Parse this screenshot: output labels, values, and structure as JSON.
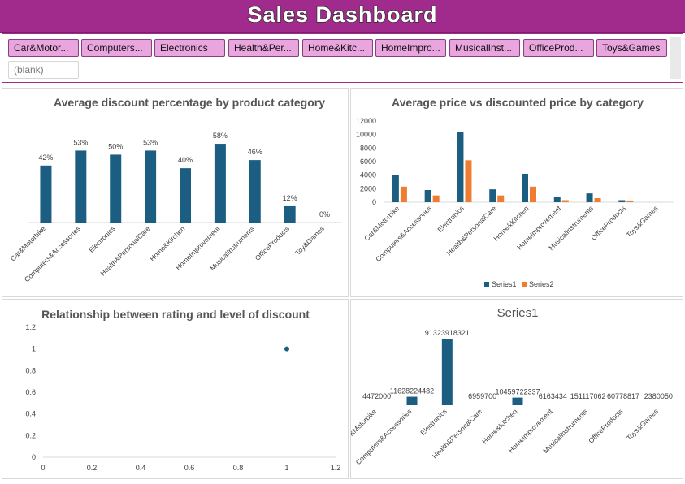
{
  "header": {
    "title": "Sales Dashboard"
  },
  "slicer": {
    "items": [
      "Car&Motor...",
      "Computers...",
      "Electronics",
      "Health&Per...",
      "Home&Kitc...",
      "HomeImpro...",
      "MusicalInst...",
      "OfficeProd...",
      "Toys&Games",
      "(blank)"
    ],
    "selected_color": "#e8a5de"
  },
  "colors": {
    "accent": "#a12b8c",
    "series1": "#1b5e82",
    "series2": "#ee7d31"
  },
  "chart_data": [
    {
      "type": "bar",
      "title": "Average discount percentage by product category",
      "categories": [
        "Car&Motorbike",
        "Computers&Accessories",
        "Electronics",
        "Health&PersonalCare",
        "Home&Kitchen",
        "HomeImprovement",
        "MusicalInstruments",
        "OfficeProducts",
        "Toy&Games"
      ],
      "values": [
        42,
        53,
        50,
        53,
        40,
        58,
        46,
        12,
        0
      ],
      "data_labels": [
        "42%",
        "53%",
        "50%",
        "53%",
        "40%",
        "58%",
        "46%",
        "12%",
        "0%"
      ],
      "ylim": [
        0,
        70
      ]
    },
    {
      "type": "bar",
      "title": "Average price vs discounted price by category",
      "categories": [
        "Car&Motorbike",
        "Computers&Accessories",
        "Electronics",
        "Health&PersonalCare",
        "Home&Kitchen",
        "HomeImprovement",
        "MusicalInstruments",
        "OfficeProducts",
        "Toys&Games"
      ],
      "series": [
        {
          "name": "Series1",
          "values": [
            4000,
            1800,
            10400,
            1900,
            4200,
            800,
            1300,
            300,
            0
          ]
        },
        {
          "name": "Series2",
          "values": [
            2300,
            1000,
            6200,
            1000,
            2300,
            300,
            600,
            250,
            0
          ]
        }
      ],
      "yticks": [
        "0",
        "2000",
        "4000",
        "6000",
        "8000",
        "10000",
        "12000"
      ],
      "ylim": [
        0,
        12000
      ],
      "legend": "bottom"
    },
    {
      "type": "scatter",
      "title": "Relationship between rating and level of discount",
      "points": [
        {
          "x": 1,
          "y": 1
        }
      ],
      "xticks": [
        "0",
        "0.2",
        "0.4",
        "0.6",
        "0.8",
        "1",
        "1.2"
      ],
      "yticks": [
        "0",
        "0.2",
        "0.4",
        "0.6",
        "0.8",
        "1",
        "1.2"
      ],
      "xlim": [
        0,
        1.2
      ],
      "ylim": [
        0,
        1.2
      ]
    },
    {
      "type": "bar",
      "title": "Series1",
      "categories": [
        "Car&Motorbike",
        "Computers&Accessories",
        "Electronics",
        "Health&PersonalCare",
        "Home&Kitchen",
        "HomeImprovement",
        "MusicalInstruments",
        "OfficeProducts",
        "Toys&Games"
      ],
      "values": [
        4472000,
        11628224482,
        91323918321,
        6959700,
        10459722337,
        6163434,
        151117062,
        60778817,
        2380050
      ],
      "data_labels": [
        "4472000",
        "11628224482",
        "91323918321",
        "6959700",
        "10459722337",
        "6163434",
        "151117062",
        "60778817",
        "2380050"
      ],
      "ylim": [
        0,
        91323918321
      ]
    }
  ]
}
